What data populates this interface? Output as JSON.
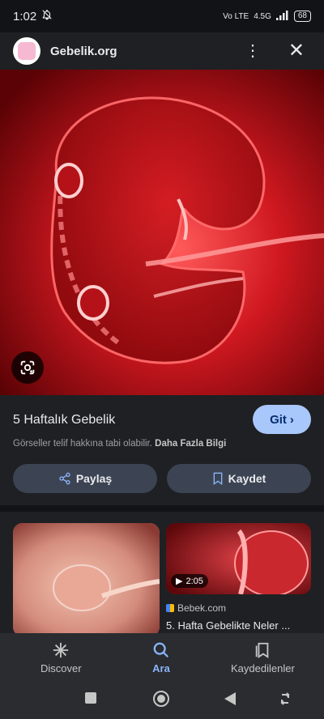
{
  "status": {
    "time": "1:02",
    "network": "4.5G",
    "volte": "Vo LTE",
    "battery": "68"
  },
  "header": {
    "site_name": "Gebelik.org"
  },
  "result": {
    "title": "5 Haftalık Gebelik",
    "go_label": "Git",
    "license_text": "Görseller telif hakkına tabi olabilir.",
    "more_info": "Daha Fazla Bilgi",
    "share_label": "Paylaş",
    "save_label": "Kaydet"
  },
  "related": {
    "items": [
      {
        "source": "",
        "title": ""
      },
      {
        "duration": "2:05",
        "source": "Bebek.com",
        "title": "5. Hafta Gebelikte Neler ..."
      }
    ]
  },
  "bottom_nav": {
    "items": [
      {
        "label": "Discover"
      },
      {
        "label": "Ara"
      },
      {
        "label": "Kaydedilenler"
      }
    ]
  },
  "colors": {
    "accent": "#a8c7fa",
    "active_nav": "#8ab4f8",
    "hero_red": "#c8141b"
  }
}
